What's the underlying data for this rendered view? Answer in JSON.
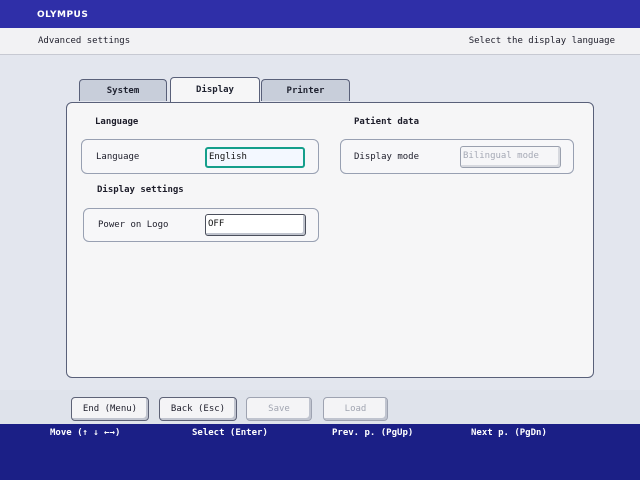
{
  "brand": "OLYMPUS",
  "header": {
    "title": "Advanced settings",
    "instruction": "Select the display language"
  },
  "tabs": [
    {
      "label": "System",
      "active": false
    },
    {
      "label": "Display",
      "active": true
    },
    {
      "label": "Printer",
      "active": false
    }
  ],
  "panel": {
    "language_section": {
      "title": "Language",
      "field_label": "Language",
      "value": "English"
    },
    "display_section": {
      "title": "Display settings",
      "field_label": "Power on Logo",
      "value": "OFF"
    },
    "patient_section": {
      "title": "Patient data",
      "field_label": "Display mode",
      "value": "Bilingual mode"
    }
  },
  "buttons": {
    "end": "End (Menu)",
    "back": "Back (Esc)",
    "save": "Save",
    "load": "Load"
  },
  "hints": {
    "move": "Move (↑ ↓ ←→)",
    "select": "Select (Enter)",
    "prev": "Prev. p. (PgUp)",
    "next": "Next p. (PgDn)"
  },
  "colors": {
    "top_bar": "#2f2fa8",
    "focus_border": "#159f8b",
    "hint_bar": "#1b1f86"
  }
}
